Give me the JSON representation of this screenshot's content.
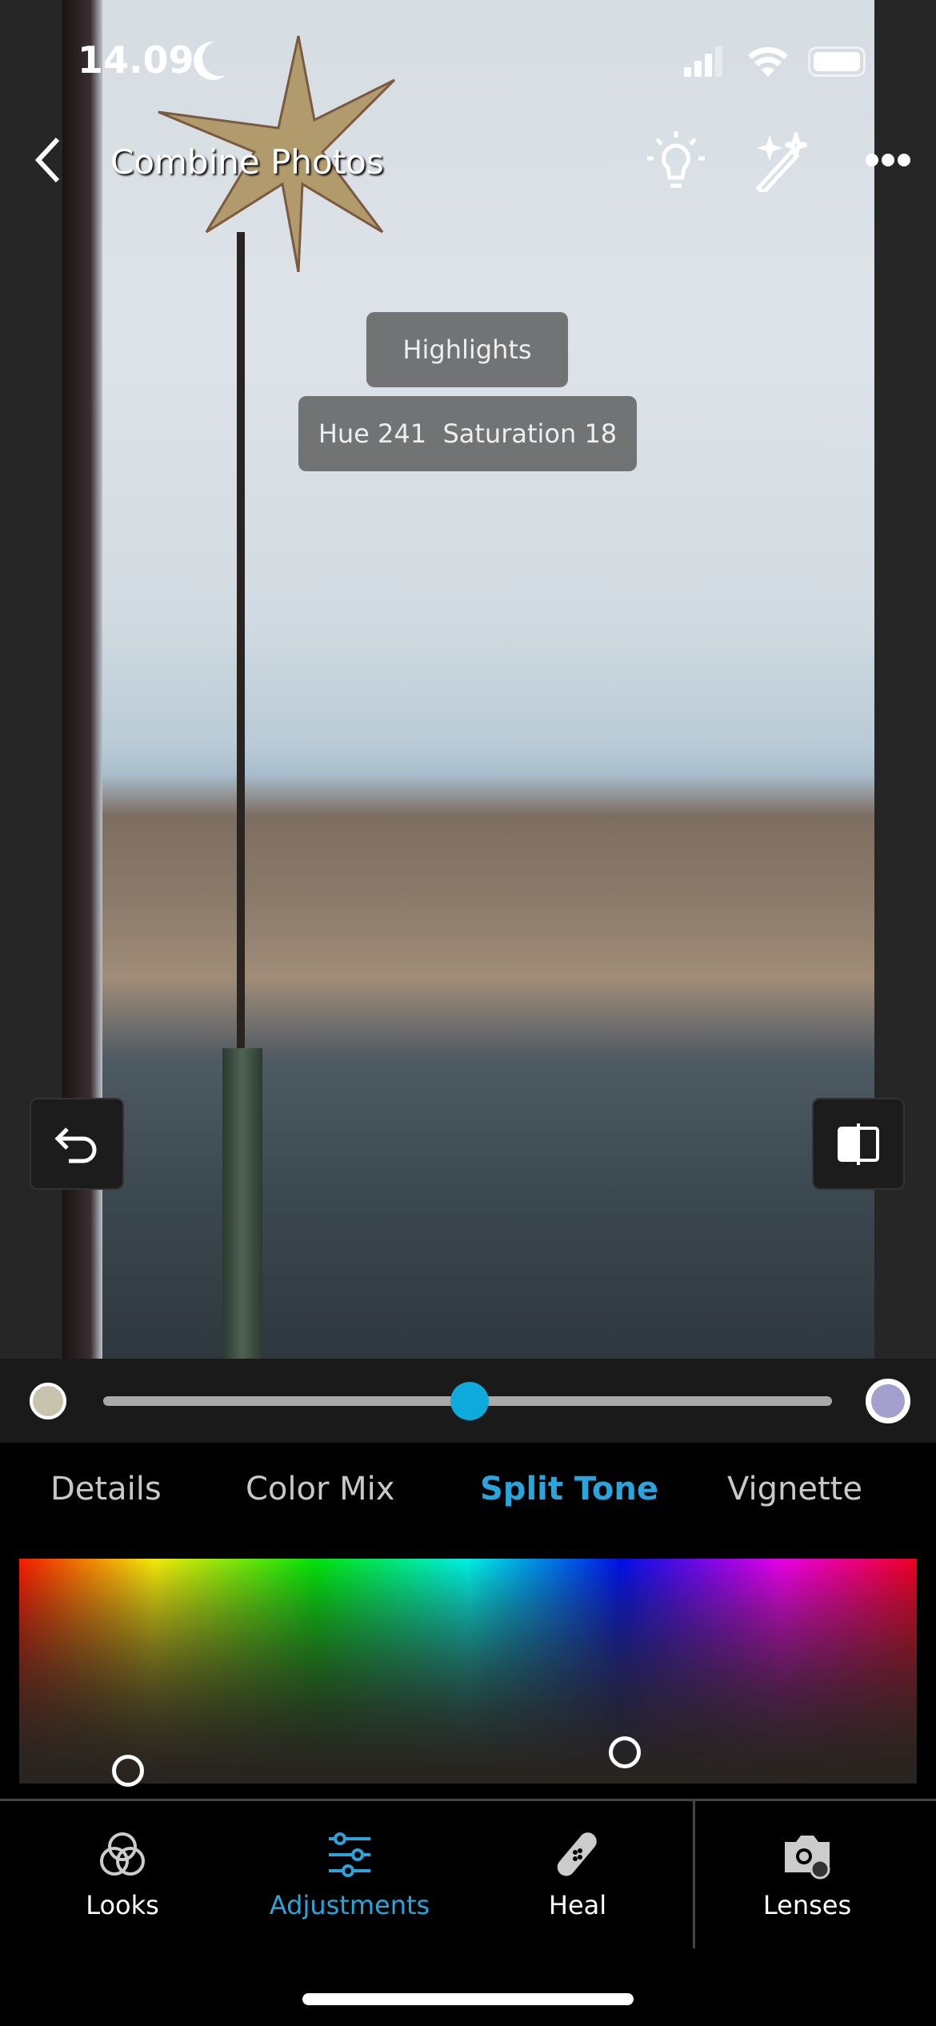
{
  "status_bar": {
    "time": "14.09"
  },
  "header": {
    "title": "Combine Photos",
    "icons": [
      "chevron-left-icon",
      "lightbulb-icon",
      "magic-wand-icon",
      "more-icon"
    ]
  },
  "tooltip": {
    "region": "Highlights",
    "values": "Hue 241  Saturation 18"
  },
  "split_tone": {
    "hue": 241,
    "saturation": 18,
    "balance_percent": 50,
    "shadows_color": "#c8c3ad",
    "highlights_color": "#a3a0cd"
  },
  "tabs": [
    {
      "label": "Details"
    },
    {
      "label": "Color Mix"
    },
    {
      "label": "Split Tone",
      "active": true
    },
    {
      "label": "Vignette"
    }
  ],
  "accent_color": "#1ea7e0",
  "bottom_nav": [
    {
      "label": "Looks",
      "icon": "looks-icon"
    },
    {
      "label": "Adjustments",
      "icon": "sliders-icon",
      "active": true
    },
    {
      "label": "Heal",
      "icon": "bandage-icon"
    },
    {
      "label": "Lenses",
      "icon": "camera-lens-icon"
    }
  ]
}
